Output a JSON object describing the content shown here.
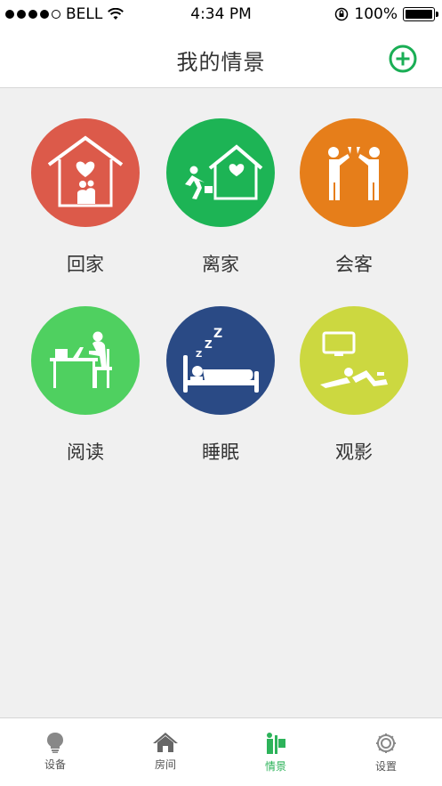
{
  "status_bar": {
    "carrier": "BELL",
    "time": "4:34 PM",
    "battery": "100%",
    "battery_level": 1.0
  },
  "nav": {
    "title": "我的情景",
    "add_icon": "plus-circle-icon",
    "accent": "#1aae55"
  },
  "scenes": [
    {
      "label": "回家",
      "color": "#dc5a4a",
      "icon": "home-family-icon"
    },
    {
      "label": "离家",
      "color": "#1db455",
      "icon": "leaving-home-icon"
    },
    {
      "label": "会客",
      "color": "#e67e1a",
      "icon": "guests-toast-icon"
    },
    {
      "label": "阅读",
      "color": "#4fd060",
      "icon": "reading-desk-icon"
    },
    {
      "label": "睡眠",
      "color": "#2a4a85",
      "icon": "sleep-bed-icon"
    },
    {
      "label": "观影",
      "color": "#ccd840",
      "icon": "watch-tv-icon"
    }
  ],
  "tabs": [
    {
      "label": "设备",
      "icon": "bulb-icon",
      "active": false
    },
    {
      "label": "房间",
      "icon": "house-icon",
      "active": false
    },
    {
      "label": "情景",
      "icon": "scene-icon",
      "active": true
    },
    {
      "label": "设置",
      "icon": "gear-icon",
      "active": false
    }
  ]
}
